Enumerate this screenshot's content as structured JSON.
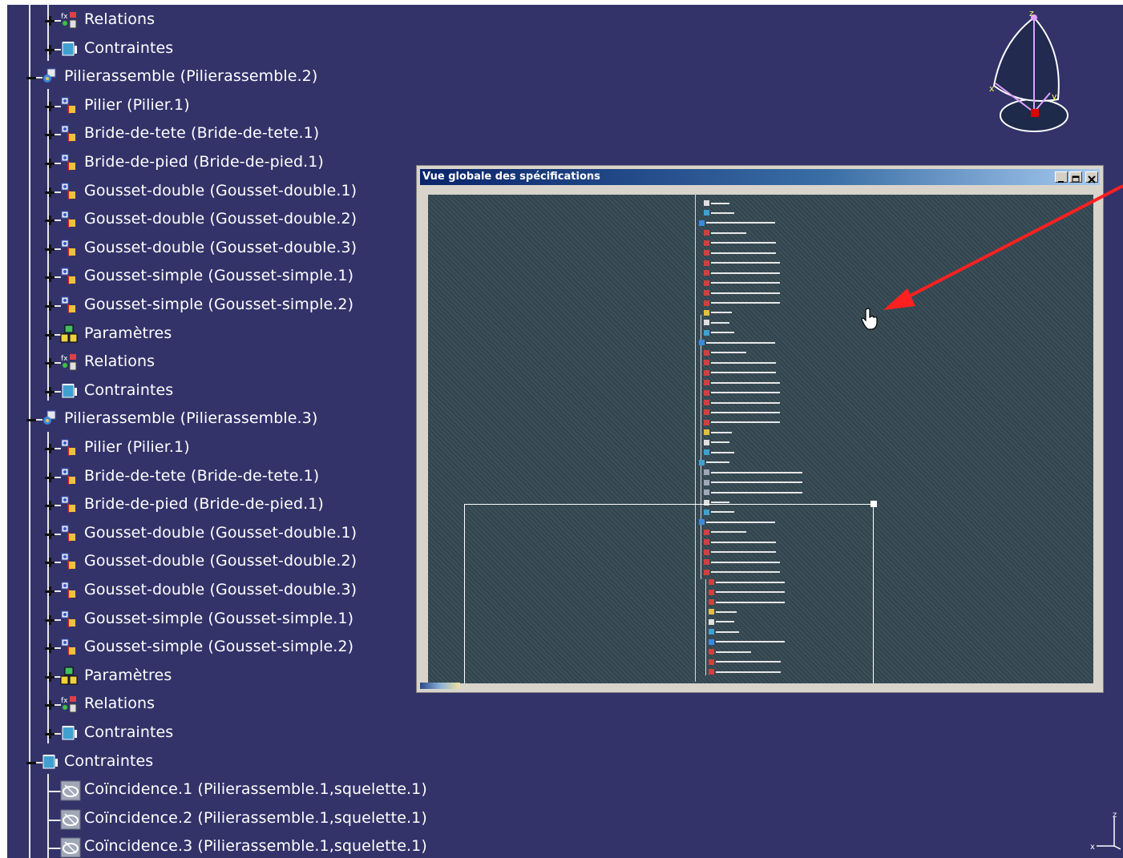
{
  "tree": {
    "rows": [
      {
        "label": "Relations",
        "level": 1,
        "icon": "relations-icon",
        "toggle": "plus"
      },
      {
        "label": "Contraintes",
        "level": 1,
        "icon": "constraints-icon",
        "toggle": "plus"
      },
      {
        "label": "Pilierassemble (Pilierassemble.2)",
        "level": 0,
        "icon": "assembly-icon",
        "toggle": "minus"
      },
      {
        "label": "Pilier (Pilier.1)",
        "level": 1,
        "icon": "part-icon",
        "toggle": "plus"
      },
      {
        "label": "Bride-de-tete (Bride-de-tete.1)",
        "level": 1,
        "icon": "part-icon",
        "toggle": "plus"
      },
      {
        "label": "Bride-de-pied (Bride-de-pied.1)",
        "level": 1,
        "icon": "part-icon",
        "toggle": "plus"
      },
      {
        "label": "Gousset-double (Gousset-double.1)",
        "level": 1,
        "icon": "part-icon",
        "toggle": "plus"
      },
      {
        "label": "Gousset-double (Gousset-double.2)",
        "level": 1,
        "icon": "part-icon",
        "toggle": "plus"
      },
      {
        "label": "Gousset-double (Gousset-double.3)",
        "level": 1,
        "icon": "part-icon",
        "toggle": "plus"
      },
      {
        "label": "Gousset-simple (Gousset-simple.1)",
        "level": 1,
        "icon": "part-icon",
        "toggle": "plus"
      },
      {
        "label": "Gousset-simple (Gousset-simple.2)",
        "level": 1,
        "icon": "part-icon",
        "toggle": "plus"
      },
      {
        "label": "Paramètres",
        "level": 1,
        "icon": "parameters-icon",
        "toggle": "plus"
      },
      {
        "label": "Relations",
        "level": 1,
        "icon": "relations-icon",
        "toggle": "plus"
      },
      {
        "label": "Contraintes",
        "level": 1,
        "icon": "constraints-icon",
        "toggle": "plus"
      },
      {
        "label": "Pilierassemble (Pilierassemble.3)",
        "level": 0,
        "icon": "assembly-icon",
        "toggle": "minus"
      },
      {
        "label": "Pilier (Pilier.1)",
        "level": 1,
        "icon": "part-icon",
        "toggle": "plus"
      },
      {
        "label": "Bride-de-tete (Bride-de-tete.1)",
        "level": 1,
        "icon": "part-icon",
        "toggle": "plus"
      },
      {
        "label": "Bride-de-pied (Bride-de-pied.1)",
        "level": 1,
        "icon": "part-icon",
        "toggle": "plus"
      },
      {
        "label": "Gousset-double (Gousset-double.1)",
        "level": 1,
        "icon": "part-icon",
        "toggle": "plus"
      },
      {
        "label": "Gousset-double (Gousset-double.2)",
        "level": 1,
        "icon": "part-icon",
        "toggle": "plus"
      },
      {
        "label": "Gousset-double (Gousset-double.3)",
        "level": 1,
        "icon": "part-icon",
        "toggle": "plus"
      },
      {
        "label": "Gousset-simple (Gousset-simple.1)",
        "level": 1,
        "icon": "part-icon",
        "toggle": "plus"
      },
      {
        "label": "Gousset-simple (Gousset-simple.2)",
        "level": 1,
        "icon": "part-icon",
        "toggle": "plus"
      },
      {
        "label": "Paramètres",
        "level": 1,
        "icon": "parameters-icon",
        "toggle": "plus"
      },
      {
        "label": "Relations",
        "level": 1,
        "icon": "relations-icon",
        "toggle": "plus"
      },
      {
        "label": "Contraintes",
        "level": 1,
        "icon": "constraints-icon",
        "toggle": "plus"
      },
      {
        "label": "Contraintes",
        "level": 0,
        "icon": "constraints-icon",
        "toggle": "minus"
      },
      {
        "label": "Coïncidence.1 (Pilierassemble.1,squelette.1)",
        "level": 1,
        "icon": "coincidence-icon",
        "toggle": "none"
      },
      {
        "label": "Coïncidence.2 (Pilierassemble.1,squelette.1)",
        "level": 1,
        "icon": "coincidence-icon",
        "toggle": "none"
      },
      {
        "label": "Coïncidence.3 (Pilierassemble.1,squelette.1)",
        "level": 1,
        "icon": "coincidence-icon",
        "toggle": "none"
      }
    ]
  },
  "overview": {
    "title": "Vue globale des spécifications",
    "minimize_icon": "minimize-icon",
    "maximize_icon": "maximize-icon",
    "close_icon": "close-icon"
  },
  "compass": {
    "z": "z",
    "x": "x",
    "y": "y"
  },
  "axes": {
    "z": "z",
    "x": "x"
  },
  "colors": {
    "background": "#33336a",
    "overview_bg": "#32444e",
    "arrow": "#ff2020",
    "title_bar": "#0a246a"
  }
}
